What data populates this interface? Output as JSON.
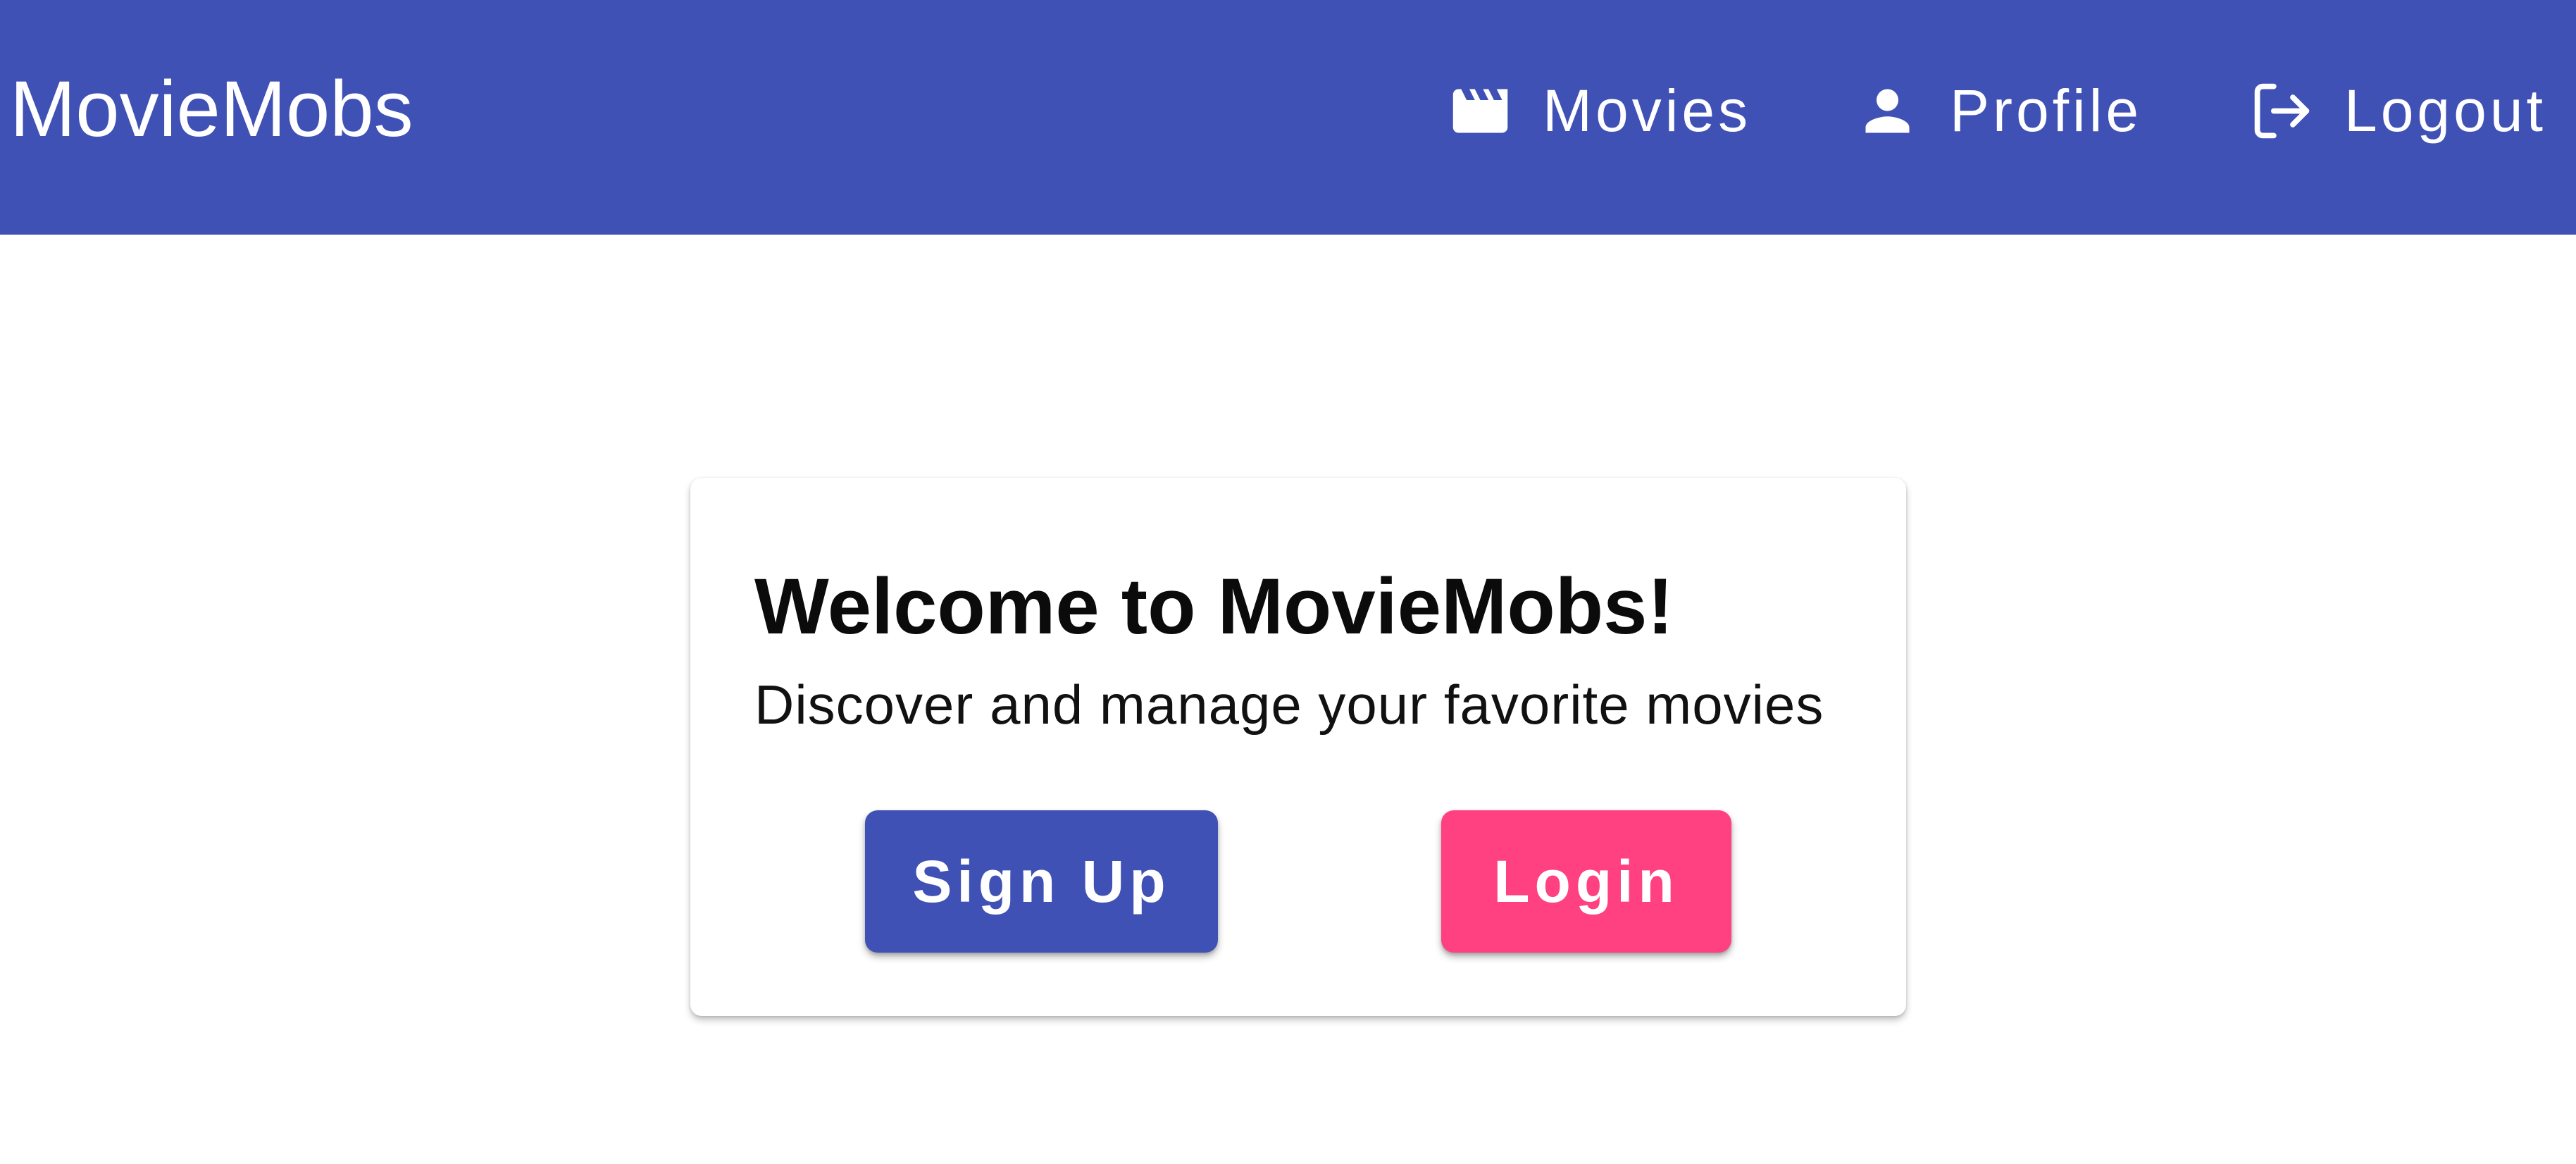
{
  "toolbar": {
    "brand": "MovieMobs",
    "background_color": "#3f51b5",
    "nav": [
      {
        "label": "Movies",
        "icon": "movie-clapper-icon"
      },
      {
        "label": "Profile",
        "icon": "person-icon"
      },
      {
        "label": "Logout",
        "icon": "logout-icon"
      }
    ]
  },
  "welcome_card": {
    "title": "Welcome to MovieMobs!",
    "subtitle": "Discover and manage your favorite movies",
    "signup_label": "Sign Up",
    "login_label": "Login",
    "signup_color": "#3f51b5",
    "login_color": "#ff4081"
  }
}
